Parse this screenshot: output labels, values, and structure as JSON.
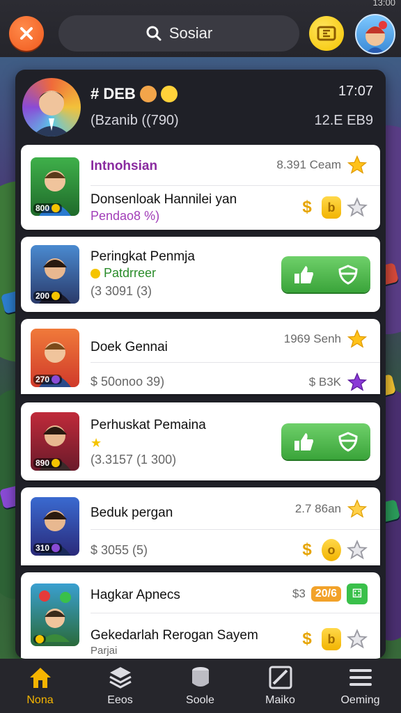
{
  "status_time": "13:00",
  "topbar": {
    "search_label": "Sosiar"
  },
  "profile": {
    "name": "# DEB",
    "subtitle": "(Bzanib ((790)",
    "time": "17:07",
    "score": "12.E EB9"
  },
  "rows": [
    {
      "title": "Intnohsian",
      "meta": "8.391 Ceam",
      "level": "800",
      "sub_title": "Donsenloak Hannilei yan",
      "sub_detail": "Pendao8 %)"
    },
    {
      "title": "Peringkat Penmja",
      "sub": "Patdrreer",
      "detail": "(3 3091 (3)",
      "level": "200"
    },
    {
      "title": "Doek Gennai",
      "meta": "1969 Senh",
      "level": "270",
      "sub_title": "$ 50onoo 39)",
      "sub_meta": "$ B3K"
    },
    {
      "title": "Perhuskat Pemaina",
      "detail": "(3.3157 (1 300)",
      "level": "890"
    },
    {
      "title": "Beduk pergan",
      "meta": "2.7 86an",
      "level": "310",
      "sub_title": "$ 3055 (5)"
    },
    {
      "title": "Hagkar Apnecs",
      "meta_prefix": "$3",
      "meta_badge": "20/6",
      "sub_title": "Gekedarlah Rerogan Sayem",
      "sub_detail": "Parjai"
    }
  ],
  "coin_symbol": "$",
  "bottom_nav": [
    {
      "label": "Nona",
      "icon": "home-icon"
    },
    {
      "label": "Eeos",
      "icon": "layers-icon"
    },
    {
      "label": "Soole",
      "icon": "cup-icon"
    },
    {
      "label": "Maiko",
      "icon": "chart-icon"
    },
    {
      "label": "Oeming",
      "icon": "menu-icon"
    }
  ],
  "colors": {
    "accent_orange": "#f05a1e",
    "accent_yellow": "#f5c400",
    "button_green": "#3aa43a",
    "active_nav": "#f5b400"
  }
}
